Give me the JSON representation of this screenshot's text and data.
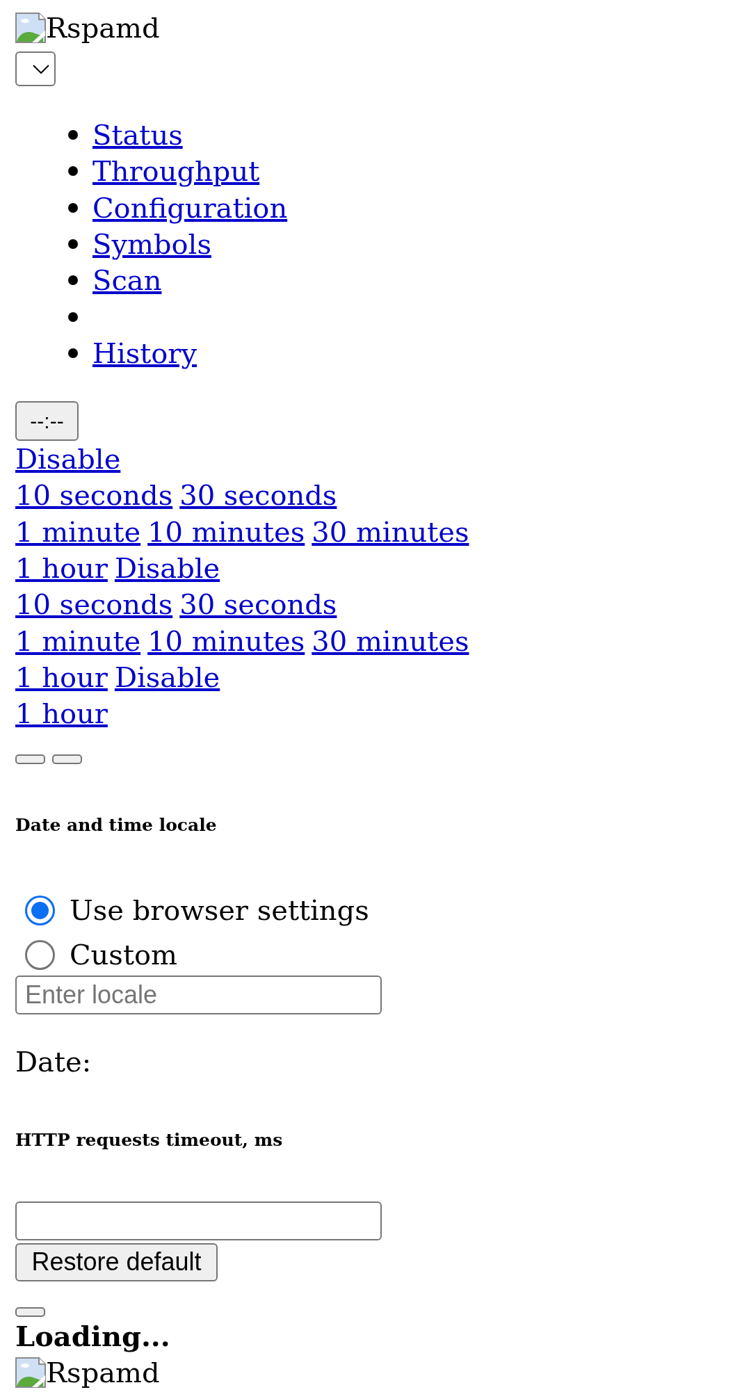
{
  "header": {
    "brand": "Rspamd"
  },
  "nav": [
    {
      "kind": "link",
      "label": "Status"
    },
    {
      "kind": "link",
      "label": "Throughput"
    },
    {
      "kind": "link",
      "label": "Configuration"
    },
    {
      "kind": "link",
      "label": "Symbols"
    },
    {
      "kind": "link",
      "label": "Scan"
    },
    {
      "kind": "blank"
    },
    {
      "kind": "link",
      "label": "History"
    }
  ],
  "refresh_button": {
    "label": "--:--"
  },
  "refresh_links": [
    [
      "Disable"
    ],
    [
      "10 seconds",
      "30 seconds"
    ],
    [
      "1 minute",
      "10 minutes",
      "30 minutes"
    ],
    [
      "1 hour",
      "Disable"
    ],
    [
      "10 seconds",
      "30 seconds"
    ],
    [
      "1 minute",
      "10 minutes",
      "30 minutes"
    ],
    [
      "1 hour",
      "Disable"
    ],
    [
      "1 hour"
    ]
  ],
  "locale_settings": {
    "title": "Date and time locale",
    "options": [
      {
        "label": "Use browser settings",
        "selected": true
      },
      {
        "label": "Custom",
        "selected": false
      }
    ],
    "locale_field": {
      "placeholder": "Enter locale"
    },
    "date_label": "Date:"
  },
  "timeout_settings": {
    "title": "HTTP requests timeout, ms",
    "restore_button": "Restore default"
  },
  "loading": "Loading...",
  "footer": {
    "brand": "Rspamd"
  }
}
